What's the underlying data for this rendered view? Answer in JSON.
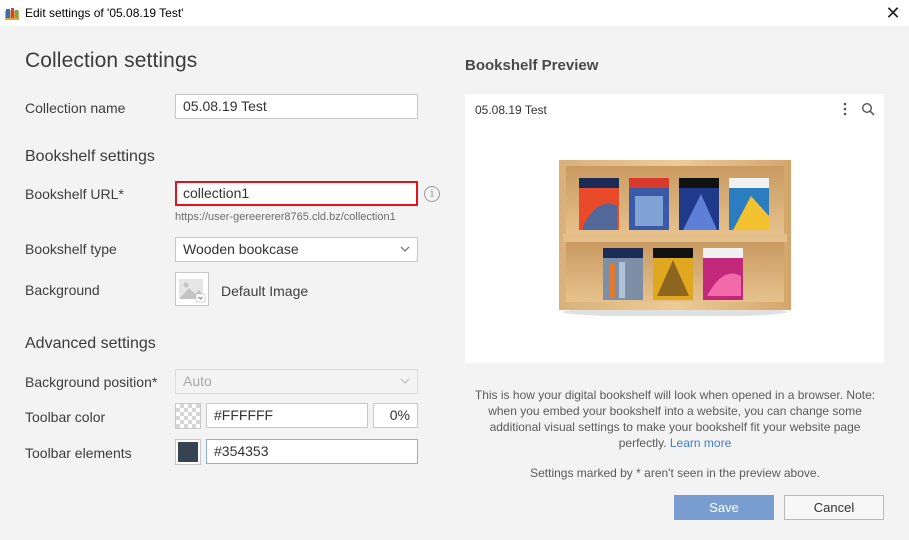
{
  "window": {
    "title": "Edit settings of '05.08.19 Test'",
    "icon": "app-icon"
  },
  "heading": "Collection settings",
  "collection_name": {
    "label": "Collection name",
    "value": "05.08.19 Test"
  },
  "bookshelf": {
    "heading": "Bookshelf settings",
    "url_label": "Bookshelf URL*",
    "url_value": "collection1",
    "url_hint": "https://user-gereererer8765.cld.bz/collection1",
    "type_label": "Bookshelf type",
    "type_value": "Wooden bookcase",
    "background_label": "Background",
    "background_value": "Default Image"
  },
  "advanced": {
    "heading": "Advanced settings",
    "bgpos_label": "Background position*",
    "bgpos_value": "Auto",
    "toolbar_color_label": "Toolbar color",
    "toolbar_color_value": "#FFFFFF",
    "toolbar_color_opacity": "0%",
    "toolbar_elements_label": "Toolbar elements",
    "toolbar_elements_value": "#354353"
  },
  "preview": {
    "title": "Bookshelf Preview",
    "collection_name": "05.08.19 Test",
    "book_count": 7,
    "note": "This is how your digital bookshelf will look when opened in a browser. Note: when you embed your bookshelf into a website, you can change some additional visual settings to make your bookshelf fit your website page perfectly.",
    "learn_more": "Learn more",
    "note2": "Settings marked by * aren't seen in the preview above."
  },
  "buttons": {
    "save": "Save",
    "cancel": "Cancel"
  },
  "colors": {
    "accent": "#7a9dd1",
    "error_border": "#e0121b",
    "toolbar_elements": "#354353",
    "link": "#3d7bd1"
  }
}
